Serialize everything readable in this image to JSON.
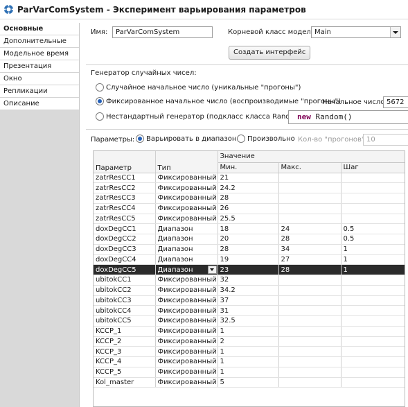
{
  "window": {
    "title": "ParVarComSystem - Эксперимент варьирования параметров",
    "icon": "experiment-gear-icon"
  },
  "sidebar": {
    "items": [
      {
        "label": "Основные",
        "active": true
      },
      {
        "label": "Дополнительные",
        "active": false
      },
      {
        "label": "Модельное время",
        "active": false
      },
      {
        "label": "Презентация",
        "active": false
      },
      {
        "label": "Окно",
        "active": false
      },
      {
        "label": "Репликации",
        "active": false
      },
      {
        "label": "Описание",
        "active": false
      }
    ]
  },
  "main": {
    "name_label": "Имя:",
    "name_value": "ParVarComSystem",
    "root_class_label": "Корневой класс модели:",
    "root_class_value": "Main",
    "create_interface_button": "Создать интерфейс",
    "rng_label": "Генератор случайных чисел:",
    "rng_options": [
      "Случайное начальное число (уникальные \"прогоны\")",
      "Фиксированное начальное число (воспроизводимые \"прогоны\")",
      "Нестандартный генератор (подкласс класса Random):"
    ],
    "rng_selected_index": 1,
    "seed_label": "Начальное число:",
    "seed_value": "5672",
    "custom_generator_code": {
      "keyword": "new",
      "rest": " Random()"
    },
    "params_label": "Параметры:",
    "params_mode_range": "Варьировать в диапазоне",
    "params_mode_free": "Произвольно",
    "runs_label": "Кол-во \"прогонов\"",
    "runs_value": "10"
  },
  "table": {
    "group_header": "Значение",
    "columns": [
      "Параметр",
      "Тип",
      "Мин.",
      "Макс.",
      "Шаг"
    ],
    "rows": [
      [
        "zatrResCC1",
        "Фиксированный",
        "21",
        "",
        ""
      ],
      [
        "zatrResCC2",
        "Фиксированный",
        "24.2",
        "",
        ""
      ],
      [
        "zatrResCC3",
        "Фиксированный",
        "28",
        "",
        ""
      ],
      [
        "zatrResCC4",
        "Фиксированный",
        "26",
        "",
        ""
      ],
      [
        "zatrResCC5",
        "Фиксированный",
        "25.5",
        "",
        ""
      ],
      [
        "doxDegCC1",
        "Диапазон",
        "18",
        "24",
        "0.5"
      ],
      [
        "doxDegCC2",
        "Диапазон",
        "20",
        "28",
        "0.5"
      ],
      [
        "doxDegCC3",
        "Диапазон",
        "28",
        "34",
        "1"
      ],
      [
        "doxDegCC4",
        "Диапазон",
        "19",
        "27",
        "1"
      ],
      [
        "doxDegCC5",
        "Диапазон",
        "23",
        "28",
        "1"
      ],
      [
        "ubitokCC1",
        "Фиксированный",
        "32",
        "",
        ""
      ],
      [
        "ubitokCC2",
        "Фиксированный",
        "34.2",
        "",
        ""
      ],
      [
        "ubitokCC3",
        "Фиксированный",
        "37",
        "",
        ""
      ],
      [
        "ubitokCC4",
        "Фиксированный",
        "31",
        "",
        ""
      ],
      [
        "ubitokCC5",
        "Фиксированный",
        "32.5",
        "",
        ""
      ],
      [
        "KCCP_1",
        "Фиксированный",
        "1",
        "",
        ""
      ],
      [
        "KCCP_2",
        "Фиксированный",
        "2",
        "",
        ""
      ],
      [
        "KCCP_3",
        "Фиксированный",
        "1",
        "",
        ""
      ],
      [
        "KCCP_4",
        "Фиксированный",
        "1",
        "",
        ""
      ],
      [
        "KCCP_5",
        "Фиксированный",
        "1",
        "",
        ""
      ],
      [
        "Kol_master",
        "Фиксированный",
        "5",
        "",
        ""
      ]
    ],
    "selected_row_index": 9
  }
}
